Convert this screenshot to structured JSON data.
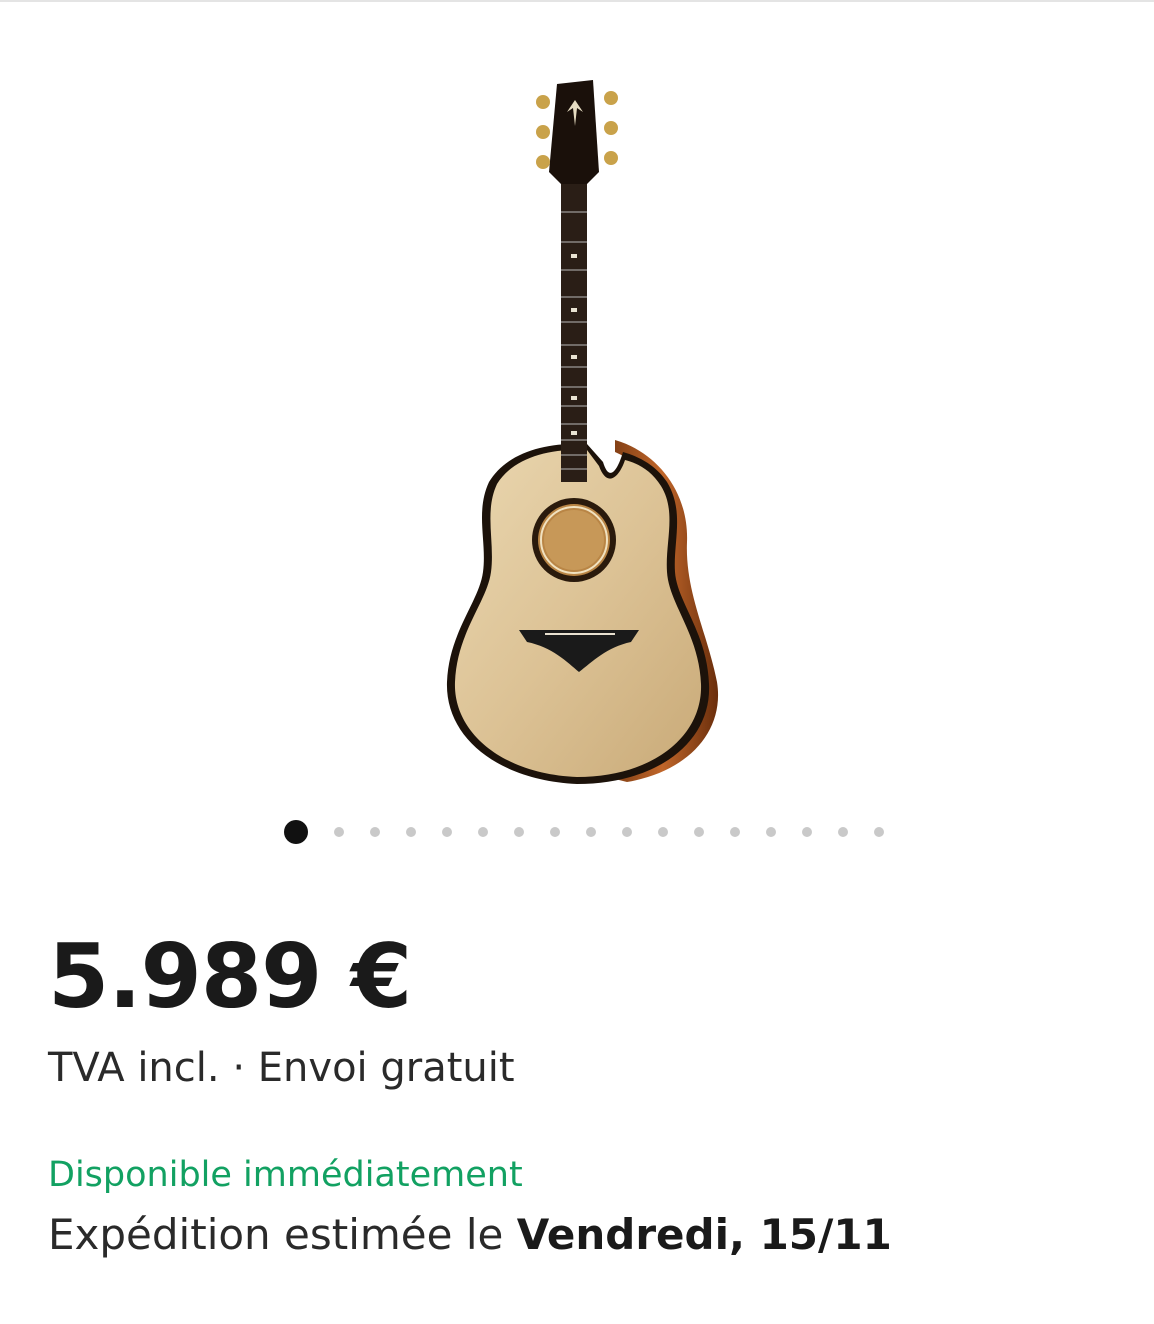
{
  "product": {
    "image_icon": "acoustic-guitar-photo",
    "gallery": {
      "total_images": 17,
      "active_index": 0
    },
    "price": "5.989 €",
    "vat_label": "TVA incl.",
    "separator": " · ",
    "shipping_label": "Envoi gratuit",
    "availability": "Disponible immédiatement",
    "shipping_estimate_prefix": "Expédition estimée le ",
    "shipping_estimate_date": "Vendredi, 15/11"
  },
  "colors": {
    "availability_green": "#12a162",
    "text_dark": "#1a1a1a",
    "dot_inactive": "#c9c9c9",
    "dot_active": "#111111"
  }
}
